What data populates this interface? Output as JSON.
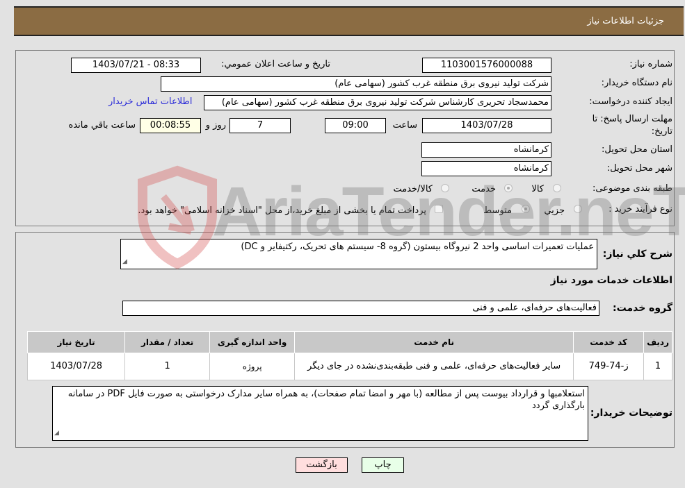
{
  "header": {
    "title": "جزئیات اطلاعات نیاز"
  },
  "fields": {
    "need_number_label": "شماره نیاز:",
    "need_number": "1103001576000088",
    "announce_label": "تاریخ و ساعت اعلان عمومي:",
    "announce_value": "1403/07/21 - 08:33",
    "buyer_org_label": "نام دستگاه خریدار:",
    "buyer_org": "شرکت تولید نیروی برق منطقه غرب کشور (سهامی عام)",
    "creator_label": "ایجاد کننده درخواست:",
    "creator": "محمدسجاد تحریری کارشناس شرکت تولید نیروی برق منطقه غرب کشور (سهامی عام)",
    "contact_link": "اطلاعات تماس خریدار",
    "deadline_label_1": "مهلت ارسال پاسخ: تا",
    "deadline_label_2": "تاریخ:",
    "deadline_date": "1403/07/28",
    "time_label": "ساعت",
    "deadline_time": "09:00",
    "days_value": "7",
    "days_label": "روز و",
    "remaining_time": "00:08:55",
    "remaining_label": "ساعت باقي مانده",
    "province_label": "استان محل تحویل:",
    "province": "کرمانشاه",
    "city_label": "شهر محل تحویل:",
    "city": "کرمانشاه",
    "category_label": "طبقه بندی موضوعی:",
    "category_options": [
      {
        "label": "کالا",
        "checked": false
      },
      {
        "label": "خدمت",
        "checked": true
      },
      {
        "label": "کالا/خدمت",
        "checked": false
      }
    ],
    "process_label": "نوع فرآیند خرید :",
    "process_options": [
      {
        "label": "جزيي",
        "checked": false
      },
      {
        "label": "متوسط",
        "checked": true
      }
    ],
    "treasury_note": "پرداخت تمام یا بخشی از مبلغ خرید،از محل \"اسناد خزانه اسلامی\" خواهد بود."
  },
  "description": {
    "label": "شرح کلي نياز:",
    "value": "عملیات تعمیرات اساسی واحد 2 نیروگاه بیستون (گروه 8-  سیستم های تحریک، رکتیفایر و DC)"
  },
  "services": {
    "section_title": "اطلاعات خدمات مورد نیاز",
    "group_label": "گروه خدمت:",
    "group_value": "فعالیت‌های حرفه‌ای، علمی و فنی",
    "table": {
      "headers": [
        "ردیف",
        "کد خدمت",
        "نام خدمت",
        "واحد اندازه گیری",
        "تعداد / مقدار",
        "تاریخ نیاز"
      ],
      "rows": [
        [
          "1",
          "ز-74-749",
          "سایر فعالیت‌های حرفه‌ای، علمی و فنی طبقه‌بندی‌نشده در جای دیگر",
          "پروژه",
          "1",
          "1403/07/28"
        ]
      ]
    }
  },
  "buyer_notes": {
    "label": "توضیحات خریدار:",
    "value": "استعلامبها و قرارداد بیوست پس از مطالعه (با مهر و امضا تمام صفحات)، به همراه سایر مدارک درخواستی به صورت فایل PDF در سامانه بارگذاری گردد"
  },
  "buttons": {
    "print": "چاپ",
    "back": "بازگشت"
  },
  "watermark": {
    "text": "AriaTender.neT"
  }
}
